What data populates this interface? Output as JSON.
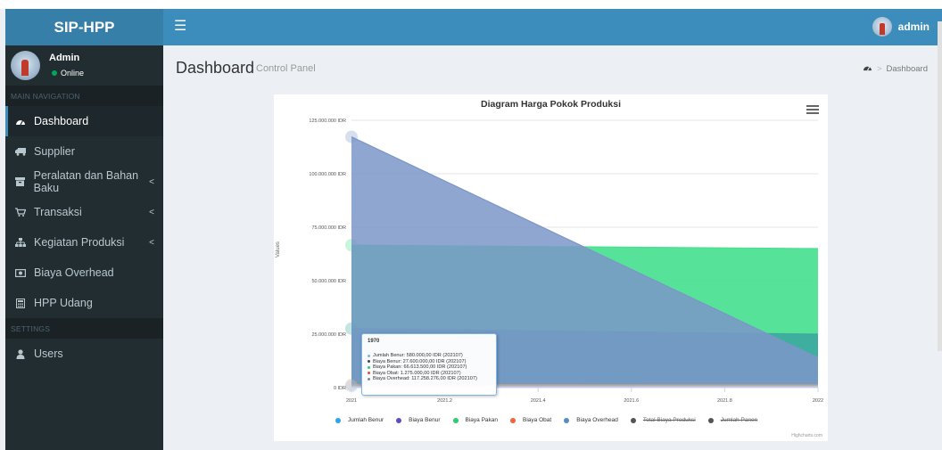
{
  "app": {
    "logo": "SIP-HPP"
  },
  "user": {
    "name": "Admin",
    "status": "Online",
    "header_name": "admin"
  },
  "sidebar": {
    "header_main": "MAIN NAVIGATION",
    "header_settings": "SETTINGS",
    "items": [
      {
        "label": "Dashboard",
        "icon": "dashboard-icon",
        "active": true
      },
      {
        "label": "Supplier",
        "icon": "truck-icon"
      },
      {
        "label": "Peralatan dan Bahan Baku",
        "icon": "archive-icon",
        "has_submenu": true
      },
      {
        "label": "Transaksi",
        "icon": "cart-icon",
        "has_submenu": true
      },
      {
        "label": "Kegiatan Produksi",
        "icon": "sitemap-icon",
        "has_submenu": true
      },
      {
        "label": "Biaya Overhead",
        "icon": "money-icon"
      },
      {
        "label": "HPP Udang",
        "icon": "calculator-icon"
      },
      {
        "label": "Users",
        "icon": "user-icon"
      }
    ],
    "chevron": "<"
  },
  "content": {
    "title": "Dashboard",
    "subtitle": "Control Panel",
    "breadcrumb": {
      "sep": ">",
      "current": "Dashboard"
    }
  },
  "chart_data": {
    "type": "area",
    "title": "Diagram Harga Pokok Produksi",
    "ylabel": "Values",
    "y_ticks": [
      "0 IDR",
      "25.000.000 IDR",
      "50.000.000 IDR",
      "75.000.000 IDR",
      "100.000.000 IDR",
      "125.000.000 IDR"
    ],
    "x_ticks": [
      "2021",
      "2021.2",
      "2021.4",
      "2021.6",
      "2021.8",
      "2022"
    ],
    "ylim": [
      0,
      125000000
    ],
    "xlim": [
      2021,
      2022
    ],
    "series": [
      {
        "name": "Jumlah Benur",
        "color": "#7cb5ec",
        "x": [
          2021,
          2022
        ],
        "values": [
          580000,
          580000
        ],
        "hidden": false
      },
      {
        "name": "Biaya Benur",
        "color": "#434348",
        "x": [
          2021,
          2022
        ],
        "values": [
          27600000,
          25000000
        ],
        "hidden": false
      },
      {
        "name": "Biaya Pakan",
        "color": "#90ed7d",
        "x": [
          2021,
          2022
        ],
        "values": [
          66613500,
          65000000
        ],
        "hidden": false
      },
      {
        "name": "Biaya Obat",
        "color": "#f7a35c",
        "x": [
          2021,
          2022
        ],
        "values": [
          1275000,
          1200000
        ],
        "hidden": false
      },
      {
        "name": "Biaya Overhead",
        "color": "#8085e9",
        "x": [
          2021,
          2022
        ],
        "values": [
          117258276,
          14000000
        ],
        "hidden": false
      },
      {
        "name": "Total Biaya Produksi",
        "color": "#555555",
        "hidden": true
      },
      {
        "name": "Jumlah Panen",
        "color": "#555555",
        "hidden": true
      }
    ],
    "tooltip": {
      "title": "1970",
      "rows": [
        {
          "text": "Jumlah Benur: 580.000,00 IDR (202107)",
          "color": "#7cb5ec"
        },
        {
          "text": "Biaya Benur: 27.600.000,00 IDR (202107)",
          "color": "#434348"
        },
        {
          "text": "Biaya Pakan: 66.613.500,00 IDR (202107)",
          "color": "#2ecc71"
        },
        {
          "text": "Biaya Obat: 1.275.000,00 IDR (202107)",
          "color": "#e74c3c"
        },
        {
          "text": "Biaya Overhead: 117.258.276,00 IDR (202107)",
          "color": "#7f8c8d"
        }
      ]
    },
    "legend": [
      {
        "name": "Jumlah Benur",
        "color": "#2fa4e7"
      },
      {
        "name": "Biaya Benur",
        "color": "#5b4fbf"
      },
      {
        "name": "Biaya Pakan",
        "color": "#2ecc71"
      },
      {
        "name": "Biaya Obat",
        "color": "#f0643c"
      },
      {
        "name": "Biaya Overhead",
        "color": "#5a8bc4"
      },
      {
        "name": "Total Biaya Produksi",
        "color": "#555555",
        "hidden": true
      },
      {
        "name": "Jumlah Panen",
        "color": "#555555",
        "hidden": true
      }
    ],
    "credit": "Highcharts.com"
  },
  "colors": {
    "header": "#3c8dbc",
    "logo": "#367fa9",
    "sidebar": "#222d32",
    "overhead_area": "#7b96c8",
    "pakan_area": "#44e08e",
    "benur_area": "#3ca9a0"
  }
}
